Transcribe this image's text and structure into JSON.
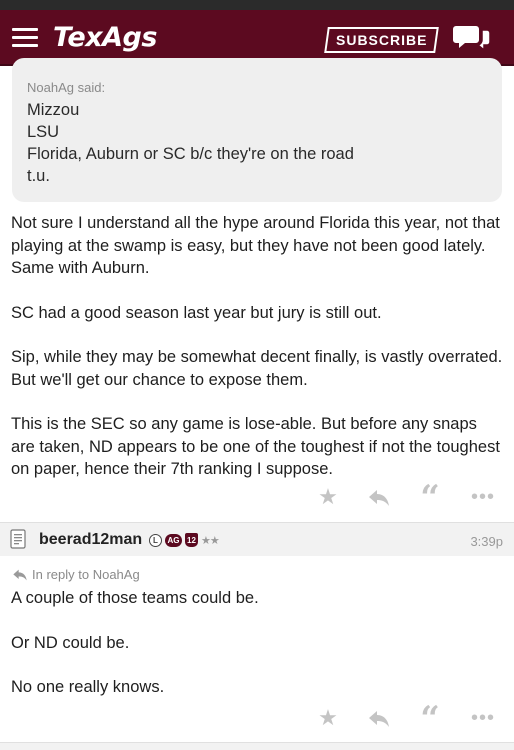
{
  "header": {
    "logo": "TexAgs",
    "subscribe_label": "SUBSCRIBE"
  },
  "quote": {
    "attribution": "NoahAg said:",
    "lines": [
      "Mizzou",
      "LSU",
      "Florida, Auburn or SC b/c they're on the road",
      "t.u."
    ]
  },
  "post1": {
    "paragraphs": [
      "Not sure I understand all the hype around Florida this year, not that playing at the swamp is easy, but they have not been good lately. Same with Auburn.",
      "SC had a good season last year but jury is still out.",
      "Sip, while they may be somewhat decent finally, is vastly overrated. But we'll get our chance to expose them.",
      "This is the SEC so any game is lose-able. But before any snaps are taken, ND appears to be one of the toughest if not the toughest on paper, hence their 7th ranking I suppose."
    ]
  },
  "post2": {
    "username": "beerad12man",
    "badges": {
      "l": "L",
      "ag": "AG",
      "shield": "12",
      "stars": "★★"
    },
    "time": "3:39p",
    "reply_to": "In reply to NoahAg",
    "paragraphs": [
      "A couple of those teams could be.",
      "Or ND could be.",
      "No one really knows."
    ]
  },
  "icons": {
    "star": "star-icon",
    "reply": "reply-icon",
    "quote": "quote-icon",
    "more": "more-icon"
  },
  "colors": {
    "brand": "#5c0a20",
    "muted_icon": "#c4c4c4"
  }
}
